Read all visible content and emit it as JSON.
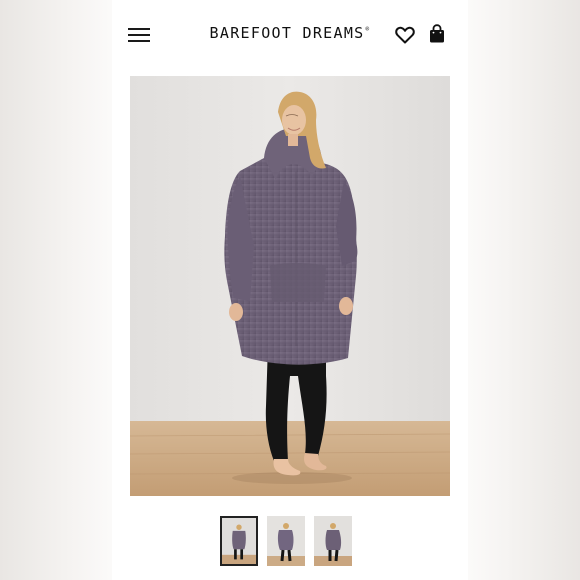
{
  "header": {
    "brand": "BAREFOOT DREAMS",
    "brand_mark": "®",
    "menu_icon": "hamburger-menu-icon",
    "wishlist_icon": "heart-icon",
    "cart_icon": "shopping-bag-icon"
  },
  "gallery": {
    "main_image": "woman wearing a purple knit hooded poncho with black leggings",
    "thumbnail_count": 3,
    "active_thumbnail": 1
  },
  "colors": {
    "poncho": "#6f6379",
    "leggings": "#151515",
    "backdrop": "#e6e4e2",
    "floor": "#c9a57f"
  }
}
